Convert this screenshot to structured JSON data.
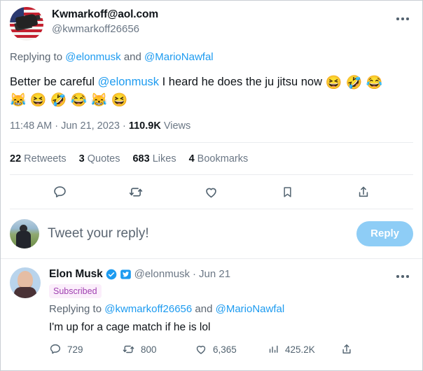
{
  "main_tweet": {
    "avatar_name": "american-flag-avatar",
    "display_name": "Kwmarkoff@aol.com",
    "handle": "@kwmarkoff26656",
    "more_menu": "more-options",
    "replying_to": {
      "prefix": "Replying to ",
      "mention_1": "@elonmusk",
      "conjunction": " and ",
      "mention_2": "@MarioNawfal"
    },
    "text": {
      "part_1": "Better be careful ",
      "mention": "@elonmusk",
      "part_2": " I heard he does the ju jitsu now ",
      "emoji_line_1": "😆 🤣 😂",
      "emoji_line_2": "😹 😆 🤣 😂 😹 😆"
    },
    "timestamp": {
      "time": "11:48 AM",
      "sep1": " · ",
      "date": "Jun 21, 2023",
      "sep2": " · ",
      "views_count": "110.9K",
      "views_label": " Views"
    },
    "stats": [
      {
        "count": "22",
        "label": " Retweets",
        "name": "retweets-stat"
      },
      {
        "count": "3",
        "label": " Quotes",
        "name": "quotes-stat"
      },
      {
        "count": "683",
        "label": " Likes",
        "name": "likes-stat"
      },
      {
        "count": "4",
        "label": " Bookmarks",
        "name": "bookmarks-stat"
      }
    ],
    "actions": [
      {
        "icon": "reply-icon"
      },
      {
        "icon": "retweet-icon"
      },
      {
        "icon": "like-heart-icon"
      },
      {
        "icon": "bookmark-icon"
      },
      {
        "icon": "share-icon"
      }
    ]
  },
  "composer": {
    "avatar_name": "current-user-avatar",
    "placeholder": "Tweet your reply!",
    "reply_button_label": "Reply",
    "reply_button_color": "#8ecdf6"
  },
  "reply": {
    "avatar_name": "elon-musk-avatar",
    "display_name": "Elon Musk",
    "verified_badge": "verified-checkmark-icon",
    "bird_badge": "twitter-bird-icon",
    "handle": "@elonmusk",
    "separator": "·",
    "date": "Jun 21",
    "subscribed_label": "Subscribed",
    "more_menu": "more-options",
    "replying_to": {
      "prefix": "Replying to ",
      "mention_1": "@kwmarkoff26656",
      "conjunction": " and ",
      "mention_2": "@MarioNawfal"
    },
    "text": "I'm up for a cage match if he is lol",
    "actions": [
      {
        "icon": "reply-icon",
        "count": "729"
      },
      {
        "icon": "retweet-icon",
        "count": "800"
      },
      {
        "icon": "like-heart-icon",
        "count": "6,365"
      },
      {
        "icon": "views-bar-chart-icon",
        "count": "425.2K"
      },
      {
        "icon": "share-icon",
        "count": ""
      }
    ]
  },
  "colors": {
    "link": "#1d9bf0",
    "verified_blue": "#1d9bf0",
    "subscribed_text": "#9f3fb0",
    "subscribed_bg": "#fbeefb",
    "icon_gray": "#536471",
    "muted_text": "#6b7785"
  }
}
